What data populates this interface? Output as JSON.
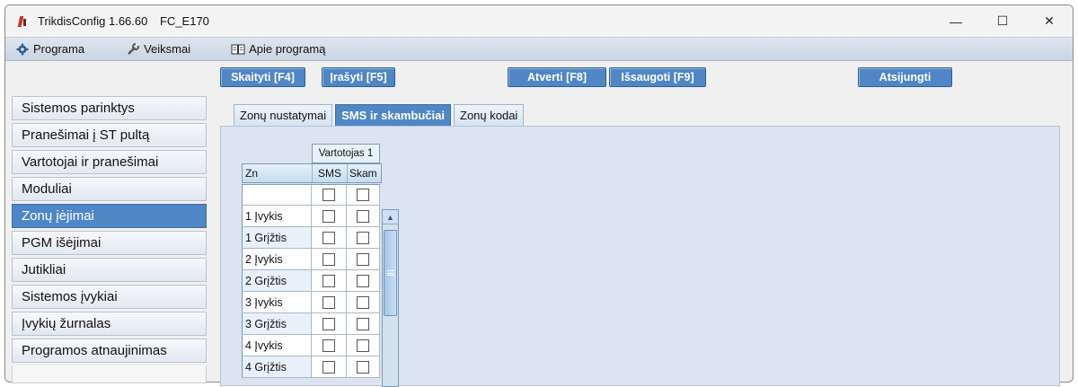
{
  "window": {
    "app_name": "TrikdisConfig 1.66.60",
    "device": "FC_E170",
    "controls": {
      "minimize": "—",
      "maximize": "☐",
      "close": "✕"
    }
  },
  "menu": {
    "items": [
      {
        "label": "Programa",
        "icon": "gear-icon"
      },
      {
        "label": "Veiksmai",
        "icon": "wrench-icon"
      },
      {
        "label": "Apie programą",
        "icon": "book-icon"
      }
    ]
  },
  "toolbar": {
    "read": "Skaityti [F4]",
    "write": "Įrašyti [F5]",
    "open": "Atverti [F8]",
    "save": "Išsaugoti [F9]",
    "disconnect": "Atsijungti"
  },
  "sidebar": {
    "items": [
      {
        "label": "Sistemos parinktys"
      },
      {
        "label": "Pranešimai į ST pultą"
      },
      {
        "label": "Vartotojai ir pranešimai"
      },
      {
        "label": "Moduliai"
      },
      {
        "label": "Zonų įėjimai"
      },
      {
        "label": "PGM išėjimai"
      },
      {
        "label": "Jutikliai"
      },
      {
        "label": "Sistemos įvykiai"
      },
      {
        "label": "Įvykių žurnalas"
      },
      {
        "label": "Programos atnaujinimas"
      }
    ],
    "active_index": 4
  },
  "tabs": {
    "items": [
      {
        "label": "Zonų nustatymai"
      },
      {
        "label": "SMS ir skambučiai"
      },
      {
        "label": "Zonų kodai"
      }
    ],
    "active_index": 1
  },
  "grid": {
    "group_header": "Vartotojas 1",
    "columns": {
      "zone": "Zn",
      "sms": "SMS",
      "call": "Skam"
    },
    "rows": [
      {
        "label": "",
        "sms": false,
        "call": false
      },
      {
        "label": "1 Įvykis",
        "sms": false,
        "call": false
      },
      {
        "label": "1 Grįžtis",
        "sms": false,
        "call": false
      },
      {
        "label": "2 Įvykis",
        "sms": false,
        "call": false
      },
      {
        "label": "2 Grįžtis",
        "sms": false,
        "call": false
      },
      {
        "label": "3 Įvykis",
        "sms": false,
        "call": false
      },
      {
        "label": "3 Grįžtis",
        "sms": false,
        "call": false
      },
      {
        "label": "4 Įvykis",
        "sms": false,
        "call": false
      },
      {
        "label": "4 Grįžtis",
        "sms": false,
        "call": false
      }
    ]
  },
  "colors": {
    "accent": "#4f86c6",
    "panel": "#dbe4f0"
  }
}
